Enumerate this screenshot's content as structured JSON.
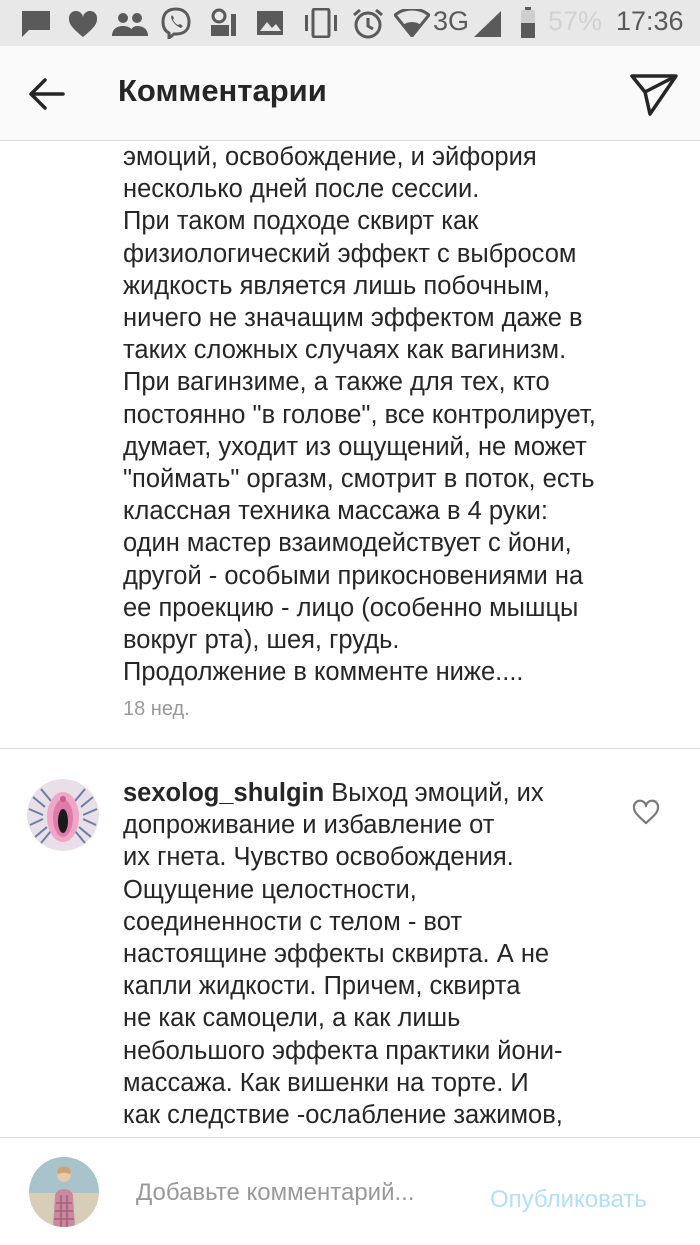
{
  "status_bar": {
    "network": "3G",
    "battery": "57%",
    "time": "17:36",
    "icons": [
      "message-icon",
      "heart-icon",
      "people-icon",
      "viber-icon",
      "app-icon",
      "image-icon",
      "vibrate-icon",
      "alarm-icon",
      "wifi-icon",
      "signal-icon",
      "battery-icon"
    ]
  },
  "header": {
    "title": "Комментарии",
    "back_icon": "arrow-left-icon",
    "send_icon": "send-icon"
  },
  "continued_comment": {
    "text": "эмоций, освобождение, и эйфория\nнесколько дней после сессии.\nПри таком подходе сквирт как\nфизиологический эффект с выбросом\nжидкость является лишь побочным,\nничего не значащим эффектом даже в\nтаких сложных случаях как вагинизм.\nПри вагинзиме, а также для тех, кто\nпостоянно \"в голове\", все контролирует,\nдумает, уходит из ощущений, не может\n\"поймать\" оргазм, смотрит в поток, есть\nклассная техника массажа в 4 руки:\nодин мастер взаимодействует с йони,\nдругой - особыми прикосновениями на\nее проекцию - лицо (особенно мышцы\nвокруг рта), шея, грудь.\nПродолжение в комменте ниже....",
    "time_ago": "18 нед."
  },
  "comment": {
    "username": "sexolog_shulgin",
    "text": " Выход эмоций, их\nдопроживание и избавление от\nих гнета. Чувство освобождения.\nОщущение целостности,\nсоединенности с телом - вот\nнастоящине эффекты сквирта. А не\nкапли жидкости. Причем, сквирта\nне как самоцели, а как лишь\nнебольшого эффекта практики йони-\nмассажа. Как вишенки на торте. И\nкак следствие -ослабление зажимов,",
    "like_icon": "heart-outline-icon"
  },
  "footer": {
    "input_placeholder": "Добавьте комментарий...",
    "publish_label": "Опубликовать"
  },
  "colors": {
    "text": "#262626",
    "muted": "#999999",
    "publish_disabled": "#b2dffc",
    "divider": "#dbdbdb",
    "statusbar_bg": "#e8e8e8"
  }
}
